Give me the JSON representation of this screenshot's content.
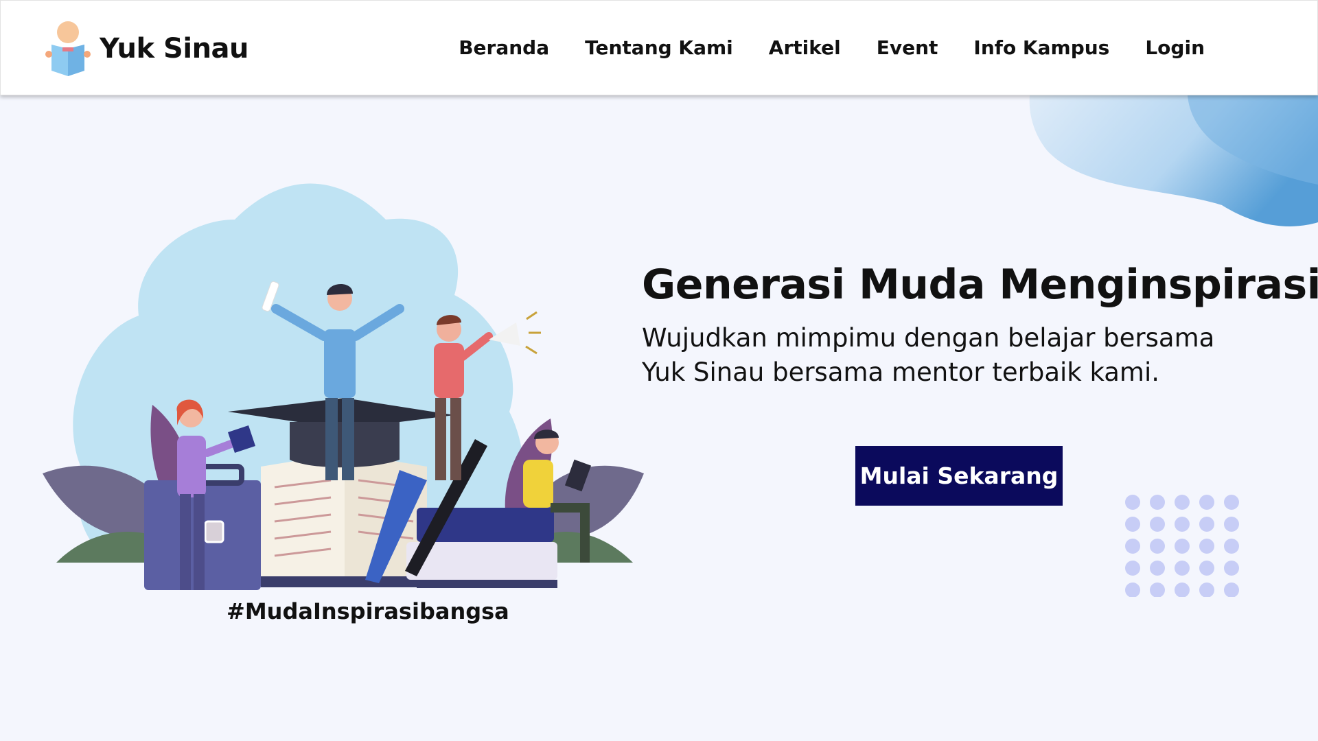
{
  "brand": {
    "name": "Yuk Sinau",
    "logo_icon": "reading-student-icon"
  },
  "nav": {
    "items": [
      {
        "label": "Beranda"
      },
      {
        "label": "Tentang Kami"
      },
      {
        "label": "Artikel"
      },
      {
        "label": "Event"
      },
      {
        "label": "Info Kampus"
      },
      {
        "label": "Login"
      }
    ]
  },
  "hero": {
    "title": "Generasi Muda Menginspirasi!",
    "subtitle_line1": "Wujudkan mimpimu dengan belajar bersama",
    "subtitle_line2": "Yuk Sinau bersama mentor terbaik kami.",
    "cta_label": "Mulai Sekarang"
  },
  "illustration": {
    "hashtag": "#MudaInspirasibangsa"
  },
  "colors": {
    "primary": "#0b0a5c",
    "background": "#f4f6fd",
    "accent_blue": "#7fb8e3",
    "dots": "#c7cdf6"
  }
}
